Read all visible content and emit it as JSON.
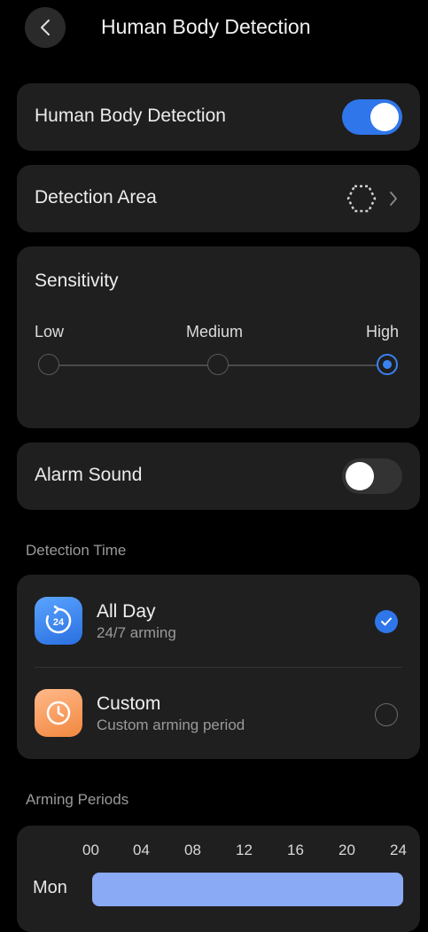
{
  "header": {
    "title": "Human Body Detection"
  },
  "human_body_detection": {
    "label": "Human Body Detection",
    "enabled": true
  },
  "detection_area": {
    "label": "Detection Area",
    "icon": "hexagon-area-icon"
  },
  "sensitivity": {
    "label": "Sensitivity",
    "levels": [
      "Low",
      "Medium",
      "High"
    ],
    "selected": "High"
  },
  "alarm_sound": {
    "label": "Alarm Sound",
    "enabled": false
  },
  "detection_time": {
    "section_label": "Detection Time",
    "options": [
      {
        "title": "All Day",
        "subtitle": "24/7 arming",
        "icon": "24-hour-icon",
        "selected": true
      },
      {
        "title": "Custom",
        "subtitle": "Custom arming period",
        "icon": "clock-icon",
        "selected": false
      }
    ]
  },
  "arming_periods": {
    "section_label": "Arming Periods",
    "hours": [
      "00",
      "04",
      "08",
      "12",
      "16",
      "20",
      "24"
    ],
    "days": [
      {
        "label": "Mon",
        "start": "00",
        "end": "24"
      }
    ]
  },
  "colors": {
    "accent": "#2f76ea",
    "bar": "#8aaaf5",
    "card": "#1f1f1f",
    "background": "#000000"
  }
}
